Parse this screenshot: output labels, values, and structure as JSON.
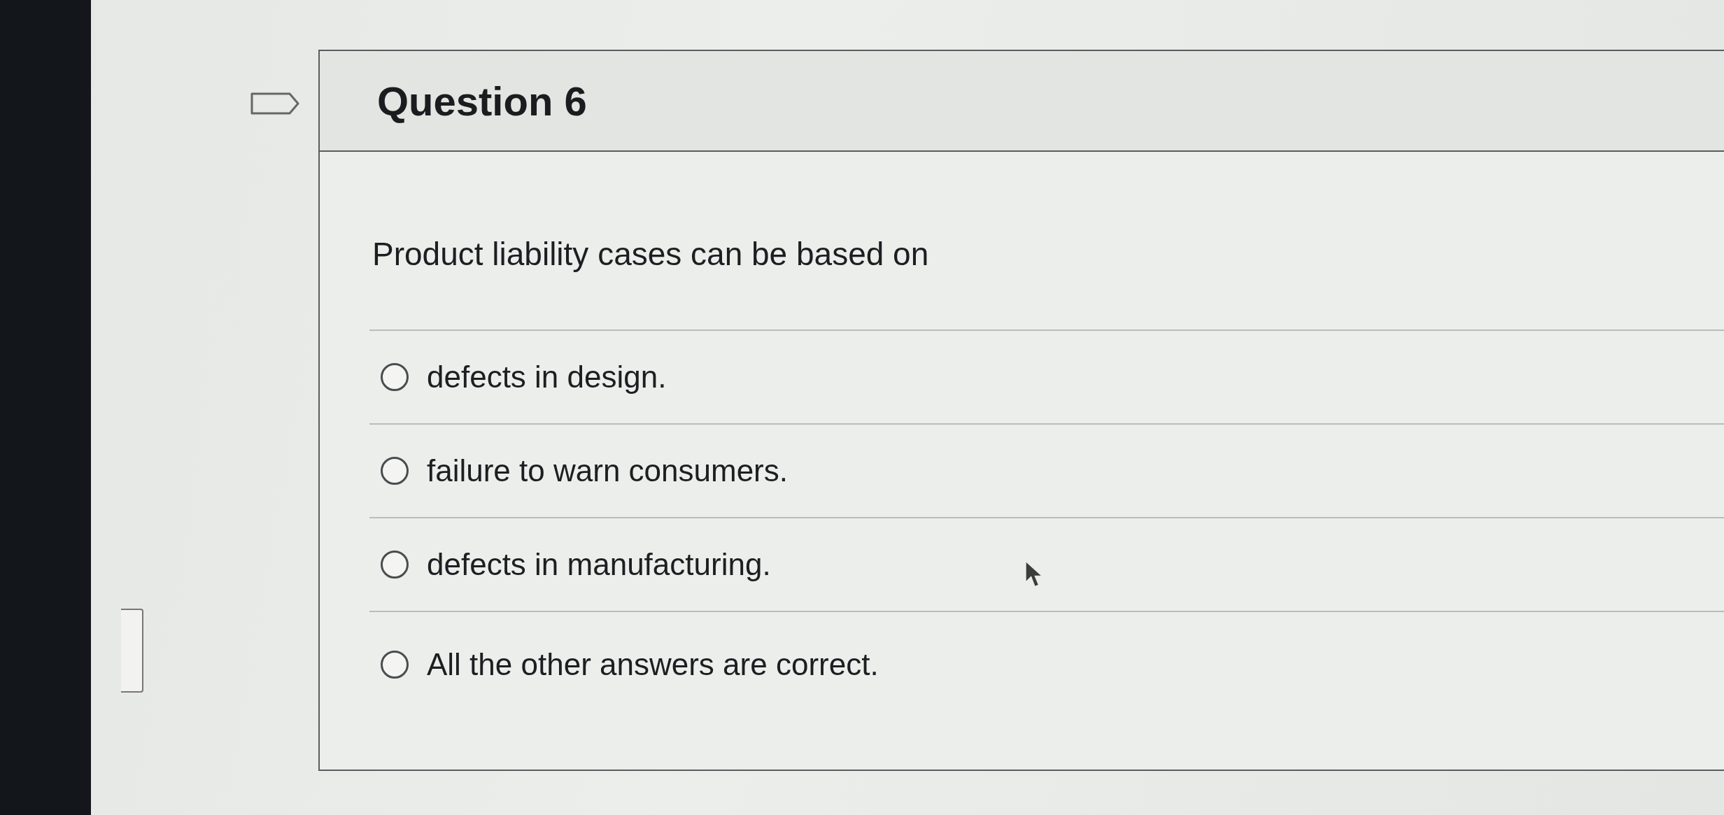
{
  "question": {
    "title": "Question 6",
    "prompt": "Product liability cases can be based on",
    "options": [
      {
        "label": "defects in design.",
        "selected": false
      },
      {
        "label": "failure to warn consumers.",
        "selected": false
      },
      {
        "label": "defects in manufacturing.",
        "selected": false
      },
      {
        "label": "All the other answers are correct.",
        "selected": false
      }
    ]
  }
}
